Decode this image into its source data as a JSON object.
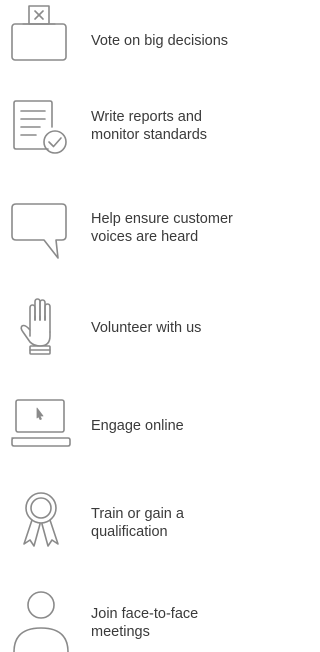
{
  "items": [
    {
      "icon": "ballot-box-icon",
      "label": "Vote on big decisions"
    },
    {
      "icon": "report-checklist-icon",
      "label": "Write reports and\nmonitor standards"
    },
    {
      "icon": "speech-bubble-icon",
      "label": "Help ensure customer\nvoices are heard"
    },
    {
      "icon": "raised-hand-icon",
      "label": "Volunteer with us"
    },
    {
      "icon": "laptop-cursor-icon",
      "label": "Engage online"
    },
    {
      "icon": "award-ribbon-icon",
      "label": "Train or gain a\nqualification"
    },
    {
      "icon": "person-icon",
      "label": "Join face-to-face\nmeetings"
    }
  ],
  "colors": {
    "icon_stroke": "#8a8a8a",
    "text": "#3a3a3a"
  }
}
